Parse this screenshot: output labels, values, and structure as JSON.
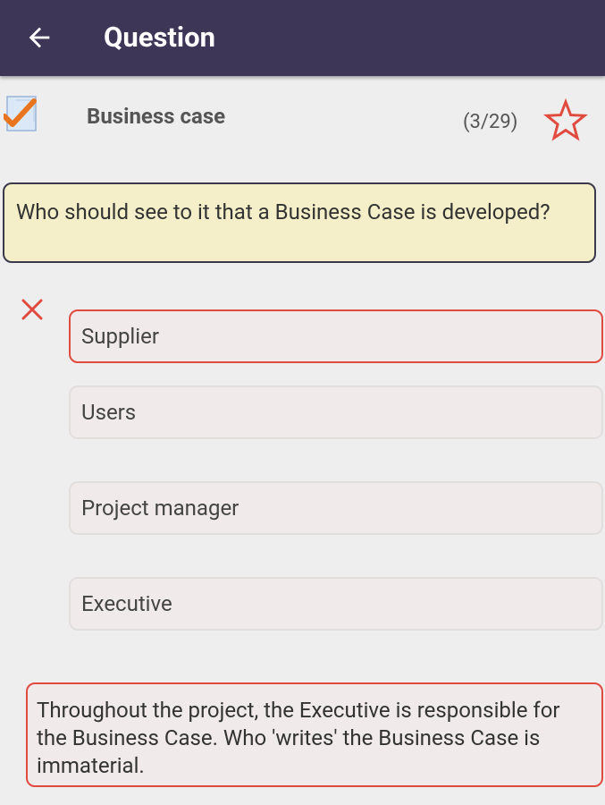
{
  "appbar": {
    "title": "Question"
  },
  "category": {
    "title": "Business case",
    "counter": "(3/29)"
  },
  "question": {
    "text": "Who should see to it that a Business Case is developed?"
  },
  "answers": [
    {
      "label": "Supplier",
      "state": "selected-wrong"
    },
    {
      "label": "Users",
      "state": "none"
    },
    {
      "label": "Project manager",
      "state": "none"
    },
    {
      "label": "Executive",
      "state": "none"
    }
  ],
  "explanation": {
    "text": "Throughout the project, the Executive is responsible for the Business Case. Who 'writes' the Business Case is immaterial."
  },
  "colors": {
    "appbar": "#3e3657",
    "wrong": "#e04a3f",
    "question_bg": "#f4efc8",
    "answer_bg": "#f0ebea"
  }
}
